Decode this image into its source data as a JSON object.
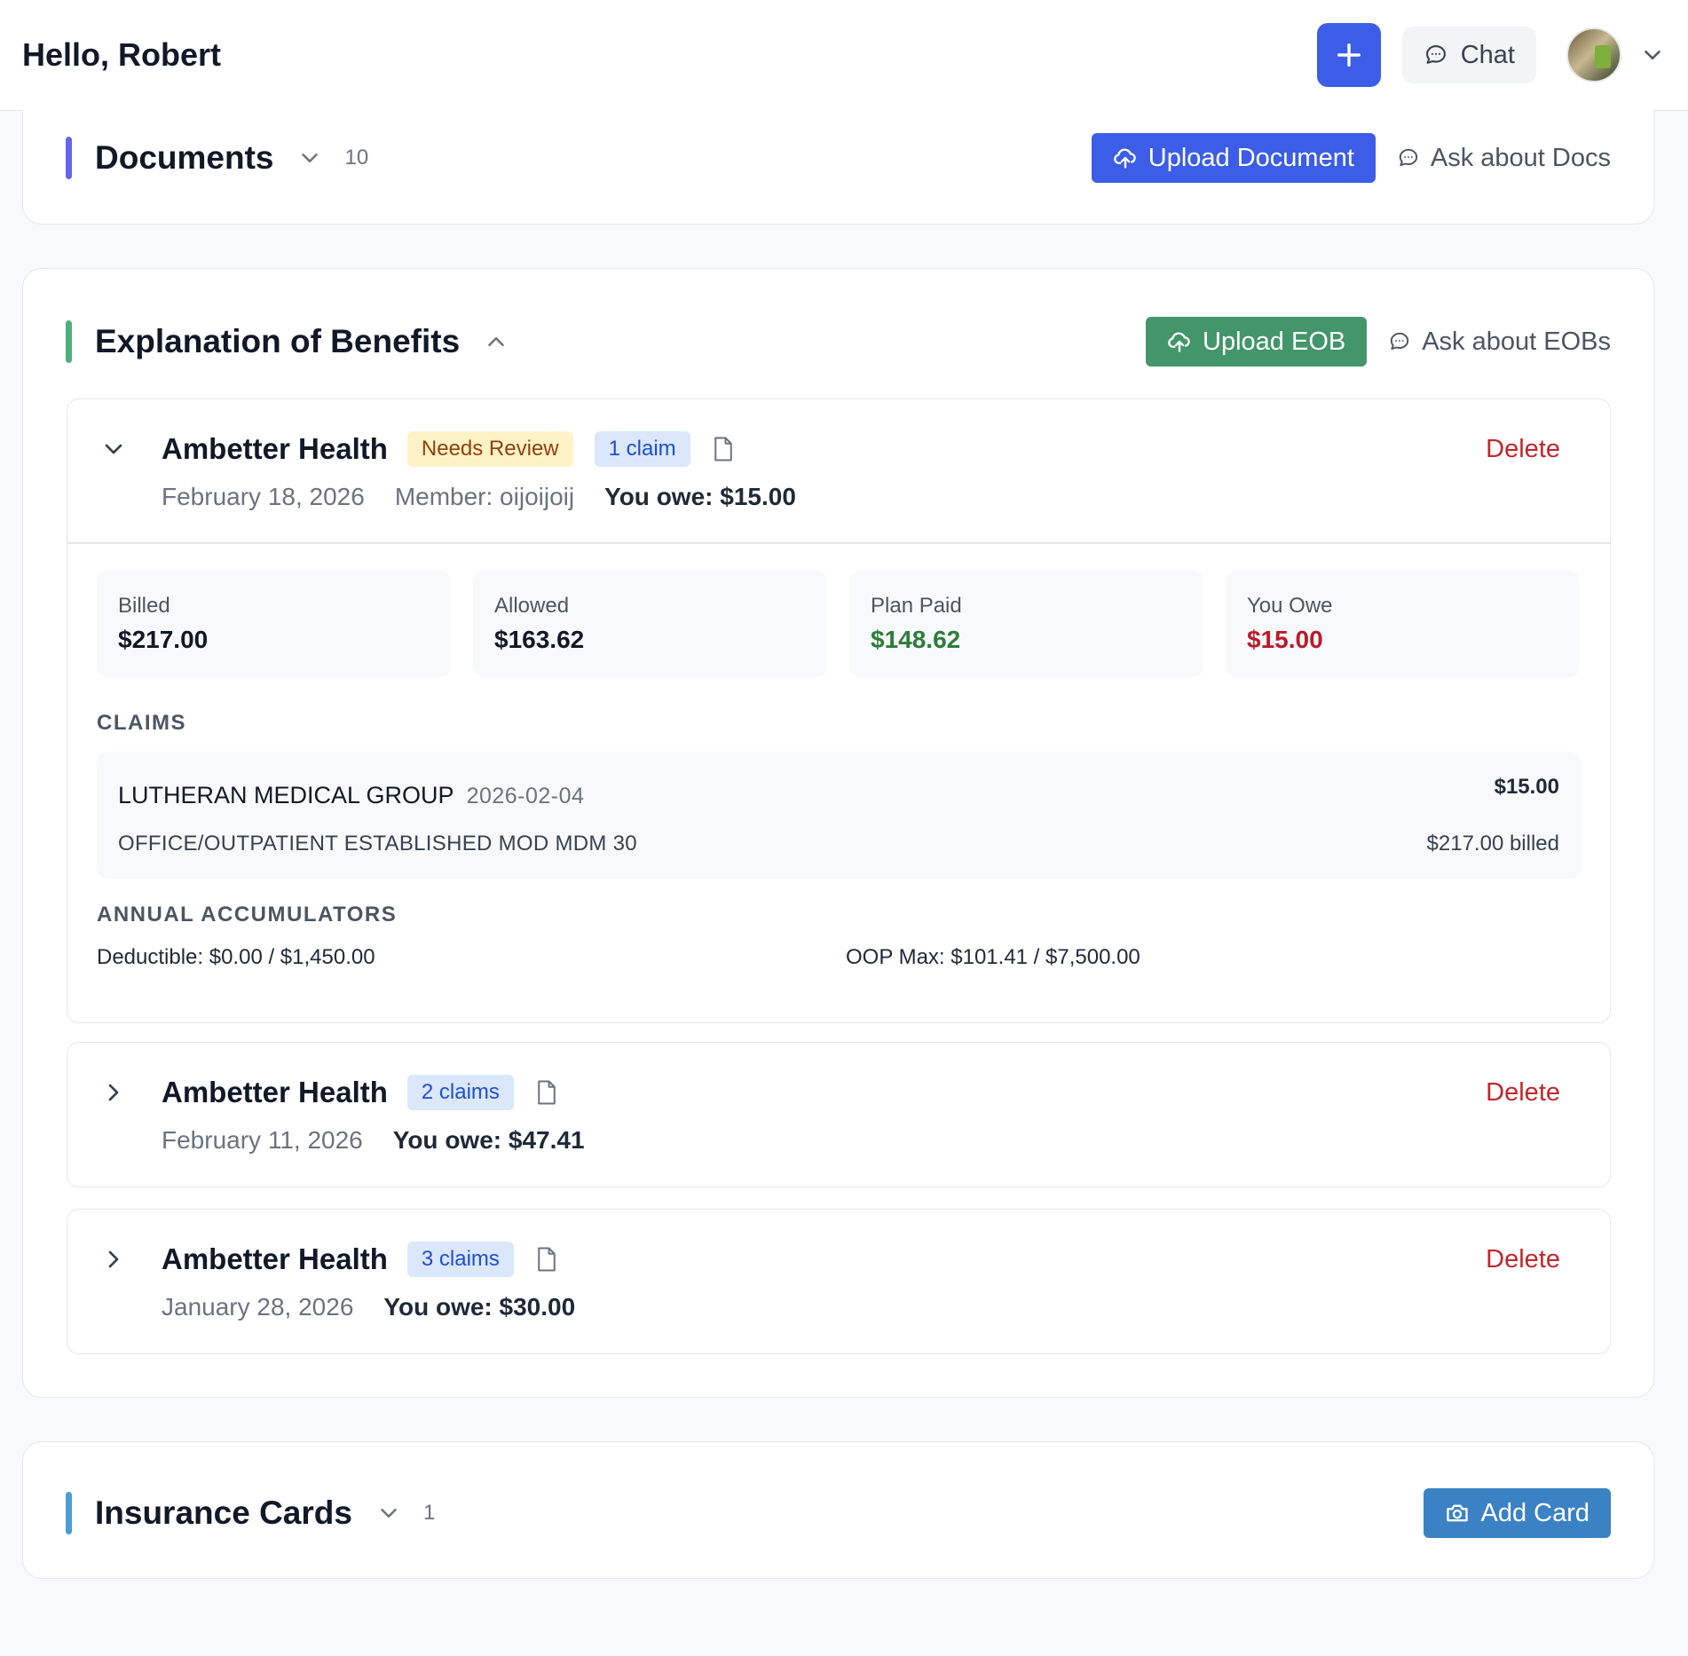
{
  "header": {
    "greeting": "Hello, Robert",
    "chat_label": "Chat"
  },
  "documents": {
    "title": "Documents",
    "count": "10",
    "upload_label": "Upload Document",
    "ask_label": "Ask about Docs",
    "accent": "#6366f1"
  },
  "eob": {
    "title": "Explanation of Benefits",
    "upload_label": "Upload EOB",
    "ask_label": "Ask about EOBs",
    "accent": "#4caf7d",
    "items": [
      {
        "payer": "Ambetter Health",
        "status": "Needs Review",
        "claims_badge": "1 claim",
        "date": "February 18, 2026",
        "member": "Member: oijoijoij",
        "you_owe": "You owe: $15.00",
        "delete_label": "Delete",
        "stats": [
          {
            "label": "Billed",
            "value": "$217.00",
            "color": "#111827"
          },
          {
            "label": "Allowed",
            "value": "$163.62",
            "color": "#111827"
          },
          {
            "label": "Plan Paid",
            "value": "$148.62",
            "color": "#2e7d3a"
          },
          {
            "label": "You Owe",
            "value": "$15.00",
            "color": "#b91c2c"
          }
        ],
        "claims_heading": "CLAIMS",
        "claims": [
          {
            "provider": "LUTHERAN MEDICAL GROUP",
            "date": "2026-02-04",
            "description": "OFFICE/OUTPATIENT ESTABLISHED MOD MDM 30",
            "amount": "$15.00",
            "billed": "$217.00 billed"
          }
        ],
        "accumulators_heading": "ANNUAL ACCUMULATORS",
        "deductible": "Deductible: $0.00 / $1,450.00",
        "oop_max": "OOP Max: $101.41 / $7,500.00"
      },
      {
        "payer": "Ambetter Health",
        "claims_badge": "2 claims",
        "date": "February 11, 2026",
        "you_owe": "You owe: $47.41",
        "delete_label": "Delete"
      },
      {
        "payer": "Ambetter Health",
        "claims_badge": "3 claims",
        "date": "January 28, 2026",
        "you_owe": "You owe: $30.00",
        "delete_label": "Delete"
      }
    ]
  },
  "insurance": {
    "title": "Insurance Cards",
    "count": "1",
    "add_label": "Add Card",
    "accent": "#4a9ed6"
  },
  "colors": {
    "primary": "#3b5de7",
    "success": "#43956a",
    "card_button": "#3b82c4",
    "danger": "#c0262d"
  }
}
